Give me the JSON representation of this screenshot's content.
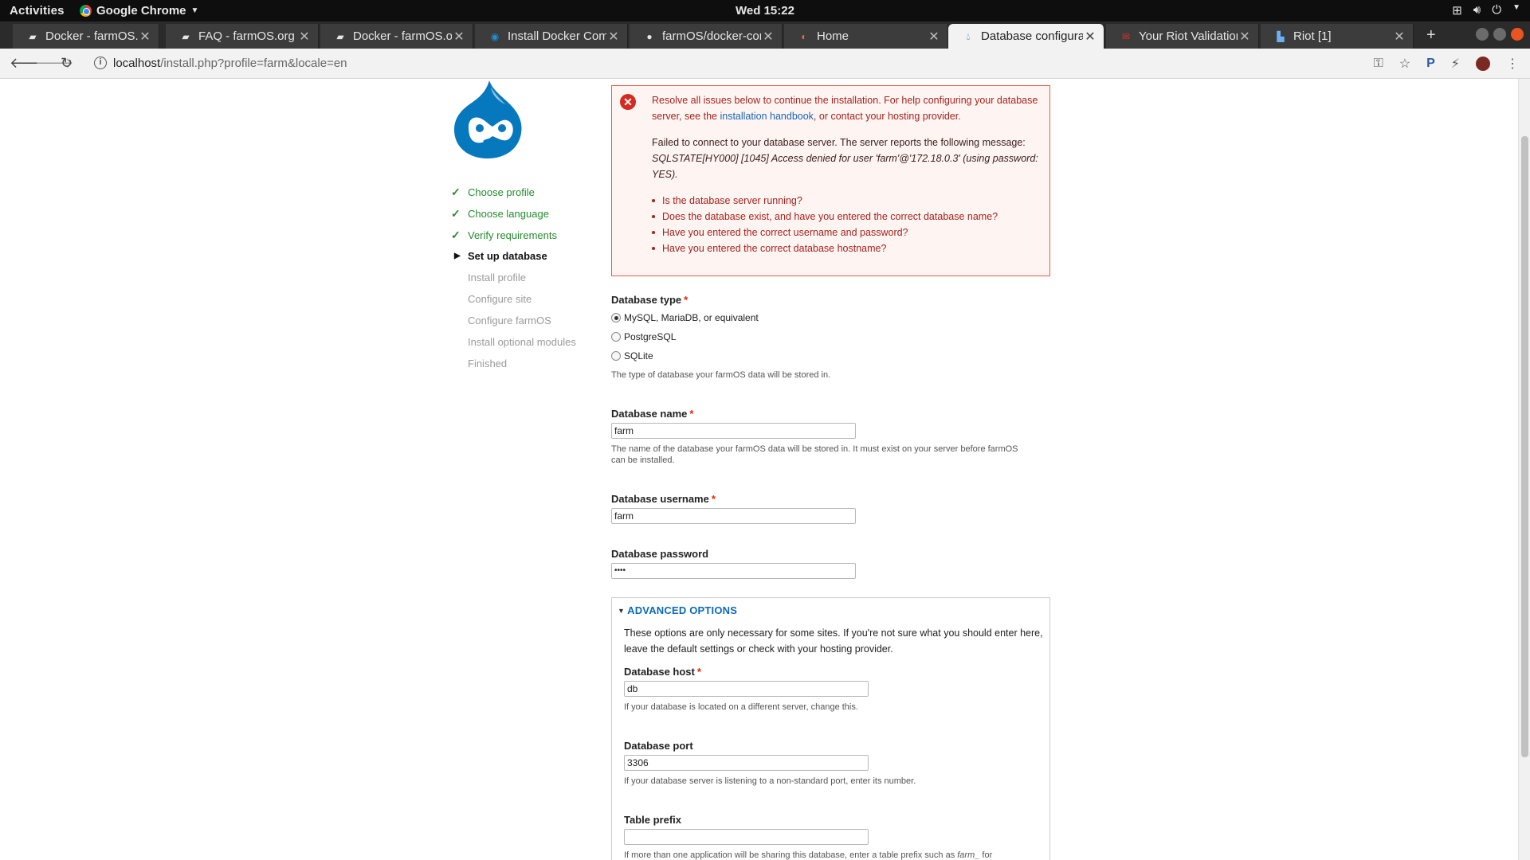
{
  "topbar": {
    "activities": "Activities",
    "app_name": "Google Chrome",
    "clock": "Wed 15:22"
  },
  "tabs": [
    {
      "title": "Docker - farmOS.org",
      "active": false
    },
    {
      "title": "FAQ - farmOS.org",
      "active": false
    },
    {
      "title": "Docker - farmOS.org",
      "active": false
    },
    {
      "title": "Install Docker Compose",
      "active": false
    },
    {
      "title": "farmOS/docker-compose",
      "active": false
    },
    {
      "title": "Home",
      "active": false
    },
    {
      "title": "Database configuration",
      "active": true
    },
    {
      "title": "Your Riot Validation",
      "active": false
    },
    {
      "title": "Riot [1]",
      "active": false
    }
  ],
  "address": {
    "host": "localhost",
    "path": "/install.php?profile=farm&locale=en"
  },
  "steps": [
    {
      "label": "Choose profile",
      "state": "done"
    },
    {
      "label": "Choose language",
      "state": "done"
    },
    {
      "label": "Verify requirements",
      "state": "done"
    },
    {
      "label": "Set up database",
      "state": "active"
    },
    {
      "label": "Install profile",
      "state": "todo"
    },
    {
      "label": "Configure site",
      "state": "todo"
    },
    {
      "label": "Configure farmOS",
      "state": "todo"
    },
    {
      "label": "Install optional modules",
      "state": "todo"
    },
    {
      "label": "Finished",
      "state": "todo"
    }
  ],
  "error": {
    "intro_before": "Resolve all issues below to continue the installation. For help configuring your database server, see the ",
    "intro_link": "installation handbook",
    "intro_after": ", or contact your hosting provider.",
    "failure_text": "Failed to connect to your database server. The server reports the following message: ",
    "failure_message": "SQLSTATE[HY000] [1045] Access denied for user 'farm'@'172.18.0.3' (using password: YES).",
    "checks": [
      "Is the database server running?",
      "Does the database exist, and have you entered the correct database name?",
      "Have you entered the correct username and password?",
      "Have you entered the correct database hostname?"
    ]
  },
  "form": {
    "db_type": {
      "label": "Database type",
      "required_mark": "*",
      "options": [
        "MySQL, MariaDB, or equivalent",
        "PostgreSQL",
        "SQLite"
      ],
      "selected": "MySQL, MariaDB, or equivalent",
      "description": "The type of database your farmOS data will be stored in."
    },
    "db_name": {
      "label": "Database name",
      "required_mark": "*",
      "value": "farm",
      "description": "The name of the database your farmOS data will be stored in. It must exist on your server before farmOS can be installed."
    },
    "db_username": {
      "label": "Database username",
      "required_mark": "*",
      "value": "farm"
    },
    "db_password": {
      "label": "Database password",
      "value": "••••"
    },
    "advanced": {
      "legend": "ADVANCED OPTIONS",
      "description": "These options are only necessary for some sites. If you're not sure what you should enter here, leave the default settings or check with your hosting provider.",
      "host": {
        "label": "Database host",
        "required_mark": "*",
        "value": "db",
        "description": "If your database is located on a different server, change this."
      },
      "port": {
        "label": "Database port",
        "value": "3306",
        "description": "If your database server is listening to a non-standard port, enter its number."
      },
      "prefix": {
        "label": "Table prefix",
        "value": "",
        "description_before": "If more than one application will be sharing this database, enter a table prefix such as ",
        "description_em": "farm_",
        "description_after": " for"
      }
    }
  }
}
